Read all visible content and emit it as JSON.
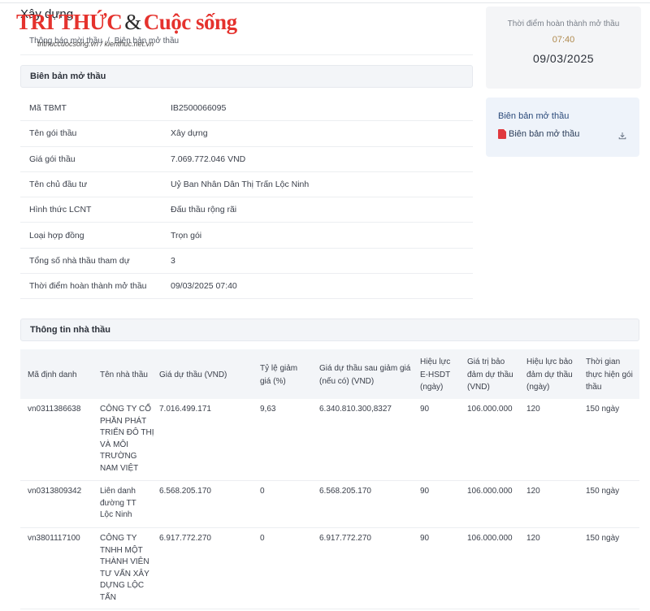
{
  "header": {
    "page_title": "Xây dựng",
    "breadcrumb": [
      "Thông báo mời thầu",
      "Biên bản mở thầu"
    ],
    "watermark": {
      "main_left": "TRI THỨC",
      "amp": "&",
      "main_right": "Cuộc sống",
      "sub": "trithuccuocsong.vn / kienthuc.net.vn"
    }
  },
  "opening_section": {
    "title": "Biên bản mở thầu",
    "rows": [
      {
        "label": "Mã TBMT",
        "value": "IB2500066095"
      },
      {
        "label": "Tên gói thầu",
        "value": "Xây dựng"
      },
      {
        "label": "Giá gói thầu",
        "value": "7.069.772.046 VND"
      },
      {
        "label": "Tên chủ đầu tư",
        "value": "Uỷ Ban Nhân Dân Thị Trấn Lộc Ninh"
      },
      {
        "label": "Hình thức LCNT",
        "value": "Đấu thầu rộng rãi"
      },
      {
        "label": "Loại hợp đồng",
        "value": "Trọn gói"
      },
      {
        "label": "Tổng số nhà thầu tham dự",
        "value": "3"
      },
      {
        "label": "Thời điểm hoàn thành mở thầu",
        "value": "09/03/2025 07:40"
      }
    ]
  },
  "completion_card": {
    "label": "Thời điểm hoàn thành mở thầu",
    "time": "07:40",
    "date": "09/03/2025"
  },
  "document_card": {
    "title": "Biên bản mở thầu",
    "file_label": "Biên bản mở thầu",
    "file_icon": "pdf-icon",
    "action_icon": "download-icon"
  },
  "contractors_section": {
    "title": "Thông tin nhà thầu",
    "columns": [
      "Mã định danh",
      "Tên nhà thầu",
      "Giá dự thầu (VND)",
      "Tỷ lệ giảm giá (%)",
      "Giá dự thầu sau giảm giá (nếu có) (VND)",
      "Hiệu lực E-HSDT (ngày)",
      "Giá trị bảo đảm dự thầu (VND)",
      "Hiệu lực bảo đảm dự thầu (ngày)",
      "Thời gian thực hiện gói thầu"
    ],
    "rows": [
      [
        "vn0311386638",
        "CÔNG TY CỔ PHẦN PHÁT TRIỂN ĐÔ THỊ VÀ MÔI TRƯỜNG NAM VIỆT",
        "7.016.499.171",
        "9,63",
        "6.340.810.300,8327",
        "90",
        "106.000.000",
        "120",
        "150 ngày"
      ],
      [
        "vn0313809342",
        "Liên danh đường TT Lộc Ninh",
        "6.568.205.170",
        "0",
        "6.568.205.170",
        "90",
        "106.000.000",
        "120",
        "150 ngày"
      ],
      [
        "vn3801117100",
        "CÔNG TY TNHH MỘT THÀNH VIÊN TƯ VẤN XÂY DỰNG LỘC TẤN",
        "6.917.772.270",
        "0",
        "6.917.772.270",
        "90",
        "106.000.000",
        "120",
        "150 ngày"
      ]
    ]
  }
}
